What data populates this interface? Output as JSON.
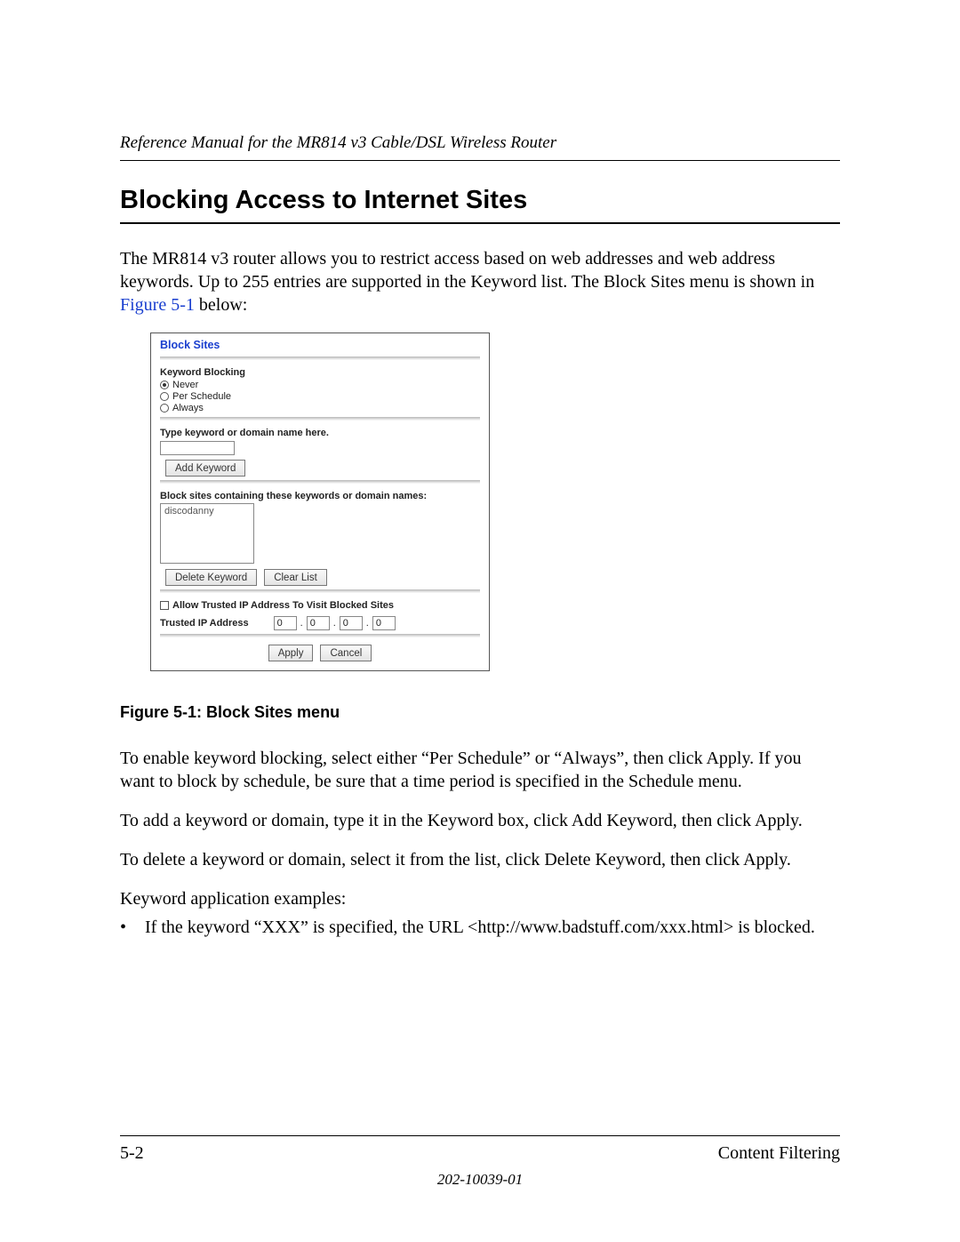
{
  "header": {
    "running": "Reference Manual for the MR814 v3 Cable/DSL Wireless Router"
  },
  "title": "Blocking Access to Internet Sites",
  "intro": {
    "text_before_link": "The MR814 v3 router allows you to restrict access based on web addresses and web address keywords. Up to 255 entries are supported in the Keyword list. The Block Sites menu is shown in ",
    "link": "Figure 5-1",
    "text_after_link": " below:"
  },
  "screenshot": {
    "title": "Block Sites",
    "keyword_blocking_label": "Keyword Blocking",
    "radios": {
      "never": "Never",
      "per_schedule": "Per Schedule",
      "always": "Always",
      "selected": "never"
    },
    "type_keyword_label": "Type keyword or domain name here.",
    "keyword_input_value": "",
    "add_keyword_btn": "Add Keyword",
    "block_list_label": "Block sites containing these keywords or domain names:",
    "block_list_items": [
      "discodanny"
    ],
    "delete_keyword_btn": "Delete Keyword",
    "clear_list_btn": "Clear List",
    "allow_trusted_label": "Allow Trusted IP Address To Visit Blocked Sites",
    "allow_trusted_checked": false,
    "trusted_ip_label": "Trusted IP Address",
    "trusted_ip": [
      "0",
      "0",
      "0",
      "0"
    ],
    "apply_btn": "Apply",
    "cancel_btn": "Cancel"
  },
  "caption": "Figure 5-1:  Block Sites menu",
  "paras": {
    "p1": "To enable keyword blocking, select either “Per Schedule” or “Always”, then click Apply. If you want to block by schedule, be sure that a time period is specified in the Schedule menu.",
    "p2": "To add a keyword or domain, type it in the Keyword box, click Add Keyword, then click Apply.",
    "p3": "To delete a keyword or domain, select it from the list, click Delete Keyword, then click Apply.",
    "p4": "Keyword application examples:",
    "bullet1": "If the keyword “XXX” is specified, the URL <http://www.badstuff.com/xxx.html> is blocked."
  },
  "footer": {
    "page": "5-2",
    "section": "Content Filtering",
    "docnum": "202-10039-01"
  }
}
